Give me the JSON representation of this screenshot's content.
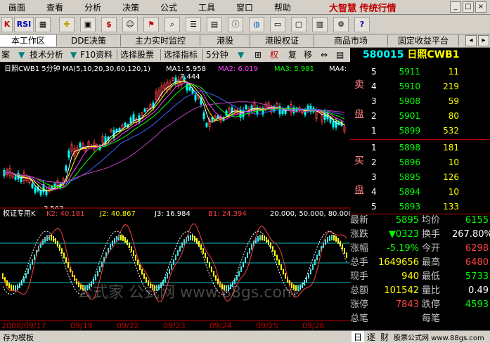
{
  "menu": {
    "items": [
      "画面",
      "查看",
      "分析",
      "决策",
      "公式",
      "工具",
      "窗口",
      "帮助"
    ],
    "logo_text": "大智慧 传统行情"
  },
  "toolbar": {
    "buttons": [
      "K",
      "RSI",
      "",
      "",
      "$",
      "",
      "",
      "",
      "",
      "",
      "",
      "",
      "",
      "",
      "",
      "",
      "",
      "",
      "",
      "",
      "?"
    ]
  },
  "tabs": [
    "本工作区",
    "DDE决策",
    "主力实时监控",
    "港股",
    "港股权证",
    "商品市场",
    "固定收益平台"
  ],
  "funcbar": {
    "items": [
      "案",
      "技术分析",
      "F10资料",
      "选择股票",
      "选择指标",
      "5分钟",
      "权",
      "复",
      "移"
    ]
  },
  "stock": {
    "code": "580015",
    "name": "日照CWB1"
  },
  "main_chart": {
    "label": "日照CWB1 5分钟 MA(5,10,20,30,60,120,1)",
    "ma1_label": "MA1: 5.958",
    "ma2_label": "MA2: 6.019",
    "ma3_label": "MA3: 5.981",
    "ma4_label": "MA4:",
    "high_label": "7.444",
    "low_label": "3.562"
  },
  "sub_chart": {
    "label": "权证专用K",
    "k2_label": "K2: 40.181",
    "j2_label": "J2: 40.867",
    "j3_label": "J3: 16.984",
    "b_label": "B1: 24.394",
    "levels_label": "20.000, 50.000, 80.000"
  },
  "dates": [
    "2008/09/17",
    "09/19",
    "09/22",
    "09/23",
    "09/24",
    "09/25",
    "09/26"
  ],
  "order_book": {
    "sell_label": "卖",
    "sell_label2": "盘",
    "buy_label": "买",
    "buy_label2": "盘",
    "sells": [
      {
        "level": "5",
        "price": "5911",
        "vol": "11"
      },
      {
        "level": "4",
        "price": "5910",
        "vol": "219"
      },
      {
        "level": "3",
        "price": "5908",
        "vol": "59"
      },
      {
        "level": "2",
        "price": "5901",
        "vol": "80"
      },
      {
        "level": "1",
        "price": "5899",
        "vol": "532"
      }
    ],
    "buys": [
      {
        "level": "1",
        "price": "5898",
        "vol": "181"
      },
      {
        "level": "2",
        "price": "5896",
        "vol": "10"
      },
      {
        "level": "3",
        "price": "5895",
        "vol": "126"
      },
      {
        "level": "4",
        "price": "5894",
        "vol": "10"
      },
      {
        "level": "5",
        "price": "5893",
        "vol": "133"
      }
    ]
  },
  "quote": [
    {
      "l": "最新",
      "v": "5895",
      "vc": "#00ff00",
      "r": "均价",
      "w": "6155",
      "wc": "#00ff00"
    },
    {
      "l": "涨跌",
      "v": "▼0323",
      "vc": "#00ff00",
      "r": "换手",
      "w": "267.80%",
      "wc": "#ffffff"
    },
    {
      "l": "涨幅",
      "v": "-5.19%",
      "vc": "#00ff00",
      "r": "今开",
      "w": "6298",
      "wc": "#ff4040"
    },
    {
      "l": "总手",
      "v": "1649656",
      "vc": "#ffff00",
      "r": "最高",
      "w": "6480",
      "wc": "#ff4040"
    },
    {
      "l": "现手",
      "v": "940",
      "vc": "#ffff00",
      "r": "最低",
      "w": "5733",
      "wc": "#00ff00"
    },
    {
      "l": "总额",
      "v": "101542",
      "vc": "#ffff00",
      "r": "量比",
      "w": "0.49",
      "wc": "#ffffff"
    },
    {
      "l": "涨停",
      "v": "7843",
      "vc": "#ff4040",
      "r": "跌停",
      "w": "4593",
      "wc": "#00ff00"
    },
    {
      "l": "总笔",
      "v": "",
      "vc": "#ffffff",
      "r": "每笔",
      "w": "",
      "wc": "#ffffff"
    }
  ],
  "watermark": "公式家 公式网 www.88gs.com",
  "status": {
    "left": "存为模板",
    "tabs": [
      "日",
      "逐",
      "财"
    ],
    "right": "股票公式网 www.88gs.com"
  },
  "colors": {
    "accent": "#c00000",
    "up": "#ff4040",
    "down": "#00ff00",
    "bg": "#000000"
  }
}
